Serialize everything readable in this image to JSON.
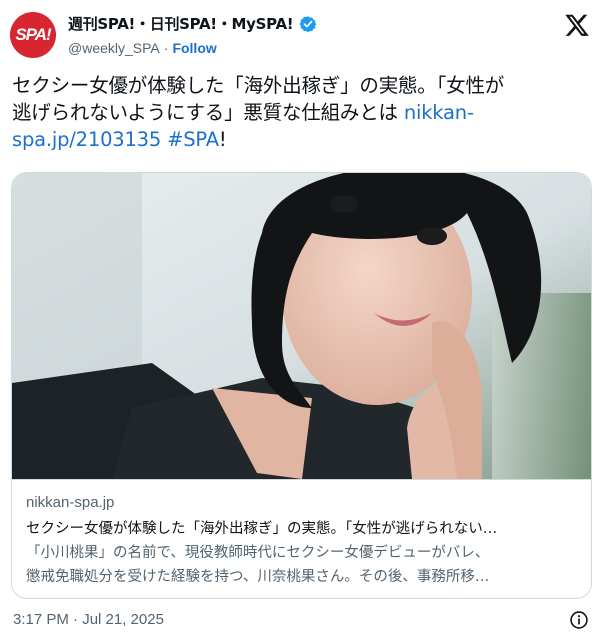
{
  "account": {
    "avatar_text": "SPA!",
    "display_name": "週刊SPA!・日刊SPA!・MySPA!",
    "handle": "@weekly_SPA",
    "separator": "·",
    "follow_label": "Follow",
    "verified_icon": "verified-badge-icon",
    "brand_color": "#d7262f",
    "verified_color": "#1d9bf0"
  },
  "tweet": {
    "text_line1": "セクシー女優が体験した「海外出稼ぎ」の実態。「女性が",
    "text_line2a": "逃げられないようにする」悪質な仕組みとは ",
    "text_link_a": "nikkan-",
    "text_link_b": "spa.jp/2103135",
    "text_space": " ",
    "hashtag": "#SPA",
    "text_end": "!",
    "link_color": "#1d6fce"
  },
  "card": {
    "domain": "nikkan-spa.jp",
    "title": "セクシー女優が体験した「海外出稼ぎ」の実態。「女性が逃げられない…",
    "desc_line1": "「小川桃果」の名前で、現役教師時代にセクシー女優デビューがバレ、",
    "desc_line2": "懲戒免職処分を受けた経験を持つ、川奈桃果さん。その後、事務所移…",
    "image": "photo-of-woman-with-short-black-hair"
  },
  "footer": {
    "timestamp": "3:17 PM · Jul 21, 2025",
    "info_icon": "info-icon"
  }
}
